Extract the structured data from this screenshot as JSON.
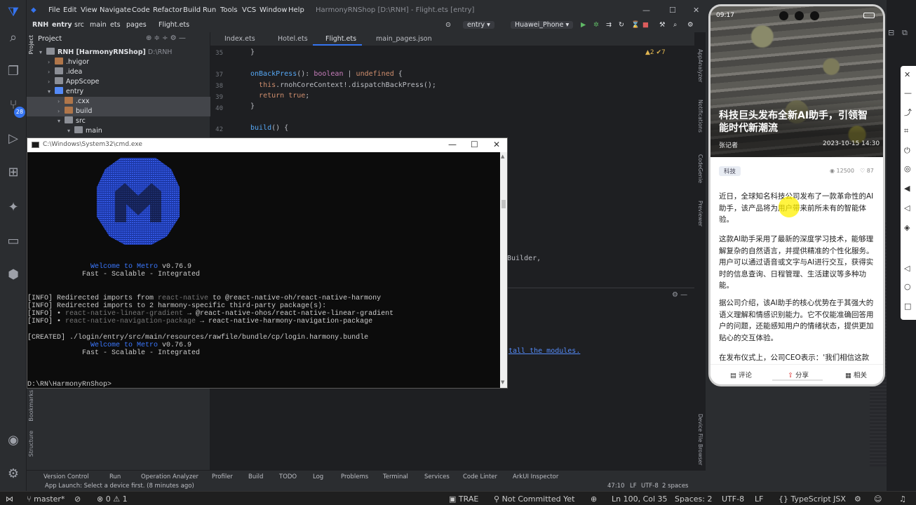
{
  "menu": {
    "items": [
      "File",
      "Edit",
      "View",
      "Navigate",
      "Code",
      "Refactor",
      "Build",
      "Run",
      "Tools",
      "VCS",
      "Window",
      "Help"
    ],
    "window_title": "HarmonyRNShop [D:\\RNH] - Flight.ets [entry]"
  },
  "breadcrumb": [
    "RNH",
    "entry",
    "src",
    "main",
    "ets",
    "pages",
    "Flight.ets"
  ],
  "run_config": "entry",
  "device": "Huawei_Phone",
  "project_panel": {
    "title": "Project",
    "tree": [
      {
        "label": "RNH [HarmonyRNShop]",
        "path": "D:\\RNH"
      },
      {
        "label": ".hvigor"
      },
      {
        "label": ".idea"
      },
      {
        "label": "AppScope"
      },
      {
        "label": "entry"
      },
      {
        "label": ".cxx"
      },
      {
        "label": "build"
      },
      {
        "label": "src"
      },
      {
        "label": "main"
      }
    ],
    "vtab_project": "Project",
    "vtab_bookmarks": "Bookmarks",
    "vtab_structure": "Structure"
  },
  "editor": {
    "tabs": [
      "Index.ets",
      "Hotel.ets",
      "Flight.ets",
      "main_pages.json"
    ],
    "warnings": "▲2 ✔7",
    "line_numbers": [
      "35",
      "36",
      "37",
      "38",
      "39",
      "40",
      "41",
      "42"
    ],
    "code_tail": "Builder,",
    "install_link": "tall the modules."
  },
  "right_vtabs": [
    "AppAnalyzer",
    "Notifications",
    "CodeGenie",
    "Previewer",
    "Device File Browser"
  ],
  "cmd": {
    "title": "C:\\Windows\\System32\\cmd.exe",
    "welcome_1": "Welcome to Metro",
    "version_1": "v0.76.9",
    "tagline_1": "Fast - Scalable - Integrated",
    "info_1a": "[INFO] Redirected imports from ",
    "info_1b": "react-native",
    "info_1c": " to @react-native-oh/react-native-harmony",
    "info_2": "[INFO] Redirected imports to 2 harmony-specific third-party package(s):",
    "info_3a": "[INFO] • ",
    "info_3b": "react-native-linear-gradient",
    "info_3c": " → @react-native-ohos/react-native-linear-gradient",
    "info_4a": "[INFO] • ",
    "info_4b": "react-native-navigation-package",
    "info_4c": " → react-native-harmony-navigation-package",
    "created": "[CREATED] ./login/entry/src/main/resources/rawfile/bundle/cp/login.harmony.bundle",
    "welcome_2": "Welcome to Metro",
    "version_2": "v0.76.9",
    "tagline_2": "Fast - Scalable - Integrated",
    "prompt": "D:\\RN\\HarmonyRnShop>"
  },
  "bottom_tools": [
    "Version Control",
    "Run",
    "Operation Analyzer",
    "Profiler",
    "Build",
    "TODO",
    "Log",
    "Problems",
    "Terminal",
    "Services",
    "Code Linter",
    "ArkUI Inspector"
  ],
  "status": {
    "message": "App Launch: Select a device first. (8 minutes ago)",
    "position": "47:10",
    "line_sep": "LF",
    "encoding": "UTF-8",
    "indent": "2 spaces"
  },
  "global_status": {
    "branch": "master*",
    "errors": "0",
    "warnings": "1",
    "trae": "TRAE",
    "commit": "Not Committed Yet",
    "cursor": "Ln 100, Col 35",
    "spaces": "Spaces: 2",
    "encoding": "UTF-8",
    "eol": "LF",
    "language": "TypeScript JSX"
  },
  "phone": {
    "time": "09:17",
    "article_title": "科技巨头发布全新AI助手，引领智能时代新潮流",
    "author": "张记者",
    "date": "2023-10-15 14:30",
    "tag": "科技",
    "views": "12500",
    "likes": "87",
    "paragraphs": [
      "近日，全球知名科技公司发布了一款革命性的AI助手，该产品将为用户带来前所未有的智能体验。",
      "这款AI助手采用了最新的深度学习技术，能够理解复杂的自然语言，并提供精准的个性化服务。用户可以通过语音或文字与AI进行交互，获得实时的信息查询、日程管理、生活建议等多种功能。",
      "据公司介绍，该AI助手的核心优势在于其强大的语义理解和情感识别能力。它不仅能准确回答用户的问题，还能感知用户的情绪状态，提供更加贴心的交互体验。",
      "在发布仪式上，公司CEO表示：'我们相信这款AI"
    ],
    "tabs": [
      "评论",
      "分享",
      "相关"
    ]
  },
  "colors": {
    "accent": "#3574f0",
    "metro_blue": "#3b78ff",
    "highlight": "#fff000"
  }
}
